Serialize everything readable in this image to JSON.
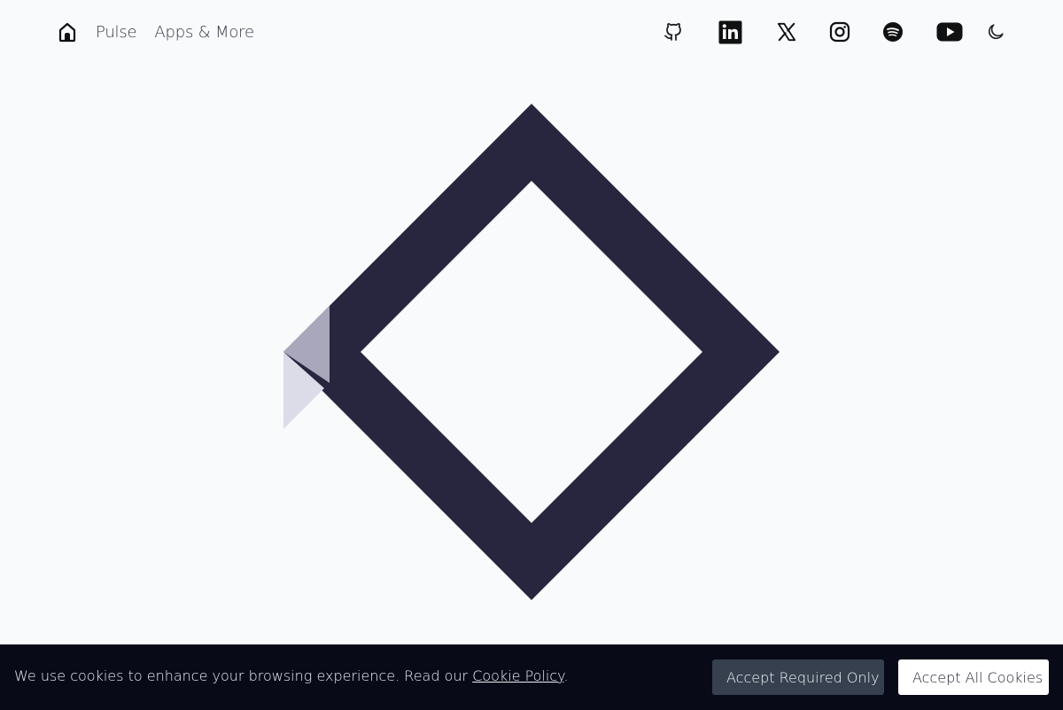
{
  "nav": {
    "home_icon": "home-icon",
    "links": [
      {
        "label": "Pulse"
      },
      {
        "label": "Apps & More"
      }
    ],
    "social": [
      {
        "name": "github-icon"
      },
      {
        "name": "linkedin-icon"
      },
      {
        "name": "x-icon"
      },
      {
        "name": "instagram-icon"
      },
      {
        "name": "spotify-icon"
      },
      {
        "name": "youtube-icon"
      },
      {
        "name": "moon-icon"
      }
    ]
  },
  "hero": {
    "logo_icon": "diamond-logo",
    "colors": {
      "primary": "#28253f",
      "fold_dark": "#a9a7bb",
      "fold_light": "#dcdbe8"
    }
  },
  "cookie": {
    "text": "We use cookies to enhance your browsing experience. Read our ",
    "link_label": "Cookie Policy",
    "text_end": ".",
    "required_label": "Accept Required Only",
    "all_label": "Accept All Cookies"
  },
  "colors": {
    "background": "#f8fafc",
    "cookie_bar": "#080a18",
    "required_button": "#36404f",
    "all_button": "#ffffff"
  }
}
